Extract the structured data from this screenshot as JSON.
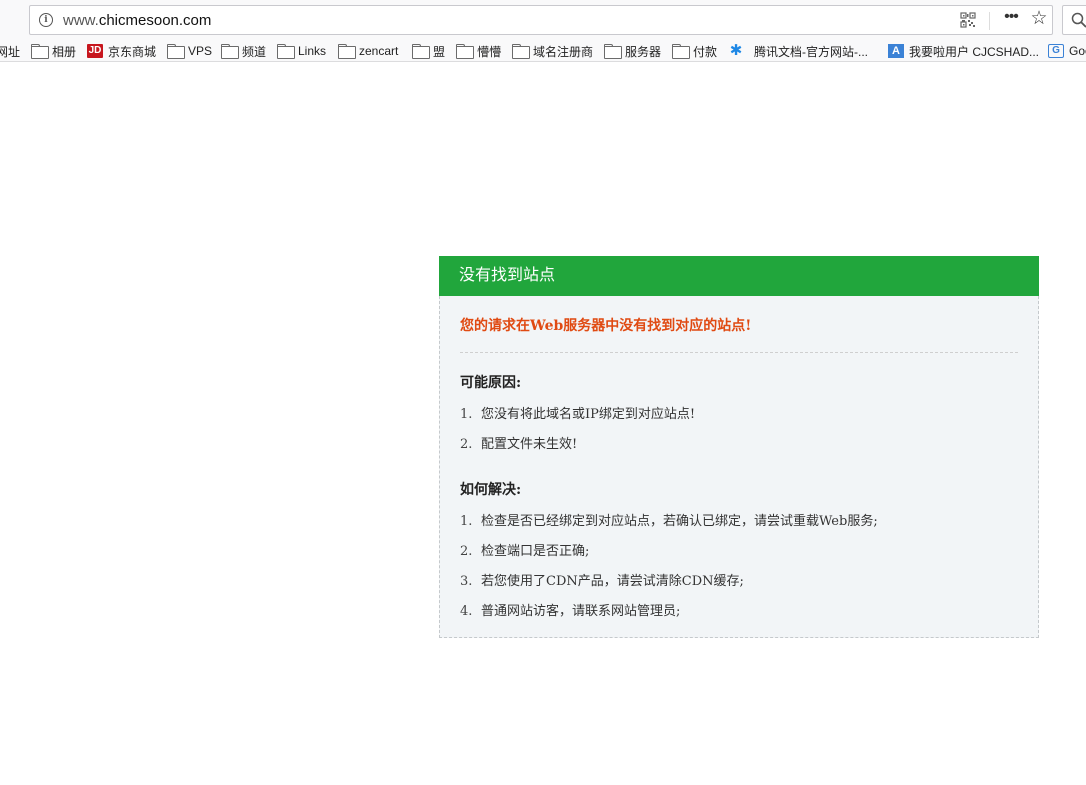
{
  "browser": {
    "url_prefix": "www.",
    "url_host": "chicmesoon.com",
    "info_icon": "i",
    "more_icon": "•••",
    "star_icon": "☆"
  },
  "bookmarks": [
    {
      "label": "网址",
      "icon": "none"
    },
    {
      "label": "相册",
      "icon": "folder-icon"
    },
    {
      "label": "京东商城",
      "icon": "jd-icon",
      "icon_text": "JD"
    },
    {
      "label": "VPS",
      "icon": "folder-icon"
    },
    {
      "label": "频道",
      "icon": "folder-icon"
    },
    {
      "label": "Links",
      "icon": "folder-icon"
    },
    {
      "label": "zencart",
      "icon": "folder-icon"
    },
    {
      "label": "盟",
      "icon": "folder-icon"
    },
    {
      "label": "懵懵",
      "icon": "folder-icon"
    },
    {
      "label": "域名注册商",
      "icon": "folder-icon"
    },
    {
      "label": "服务器",
      "icon": "folder-icon"
    },
    {
      "label": "付款",
      "icon": "folder-icon"
    },
    {
      "label": "腾讯文档-官方网站-...",
      "icon": "tencent-docs-icon",
      "icon_text": "✱"
    },
    {
      "label": "我要啦用户 CJCSHAD...",
      "icon": "a-icon",
      "icon_text": "A"
    },
    {
      "label": "Goo",
      "icon": "google-icon",
      "icon_text": "G"
    }
  ],
  "panel": {
    "title": "没有找到站点",
    "warning": "您的请求在Web服务器中没有找到对应的站点!",
    "reasons_title": "可能原因:",
    "reasons": [
      {
        "num": "1.",
        "text": "您没有将此域名或IP绑定到对应站点!"
      },
      {
        "num": "2.",
        "text": "配置文件未生效!"
      }
    ],
    "solutions_title": "如何解决:",
    "solutions": [
      {
        "num": "1.",
        "text": "检查是否已经绑定到对应站点，若确认已绑定，请尝试重载Web服务;"
      },
      {
        "num": "2.",
        "text": "检查端口是否正确;"
      },
      {
        "num": "3.",
        "text": "若您使用了CDN产品，请尝试清除CDN缓存;"
      },
      {
        "num": "4.",
        "text": "普通网站访客，请联系网站管理员;"
      }
    ]
  },
  "colors": {
    "header_green": "#21a63c",
    "warning_orange": "#e04a12",
    "panel_bg": "#f2f5f7"
  }
}
